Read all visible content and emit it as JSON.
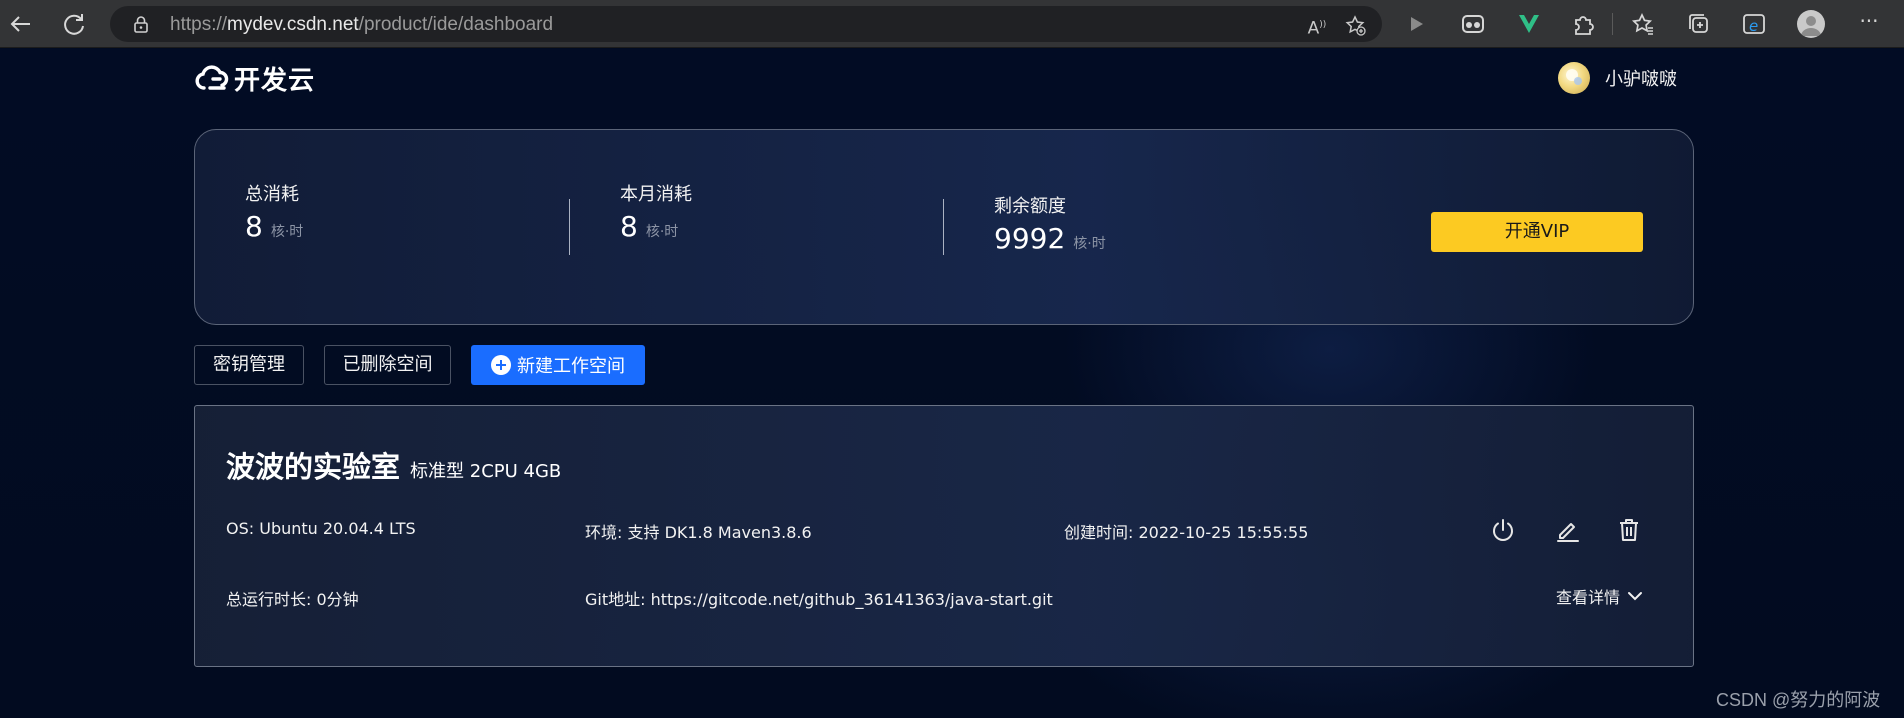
{
  "browser": {
    "url_prefix": "https://",
    "url_host": "mydev.csdn.net",
    "url_path": "/product/ide/dashboard",
    "icons": [
      "back-icon",
      "refresh-icon",
      "lock-icon",
      "read-aloud-icon",
      "favorite-add-icon",
      "play-icon",
      "extension-icon",
      "vue-icon",
      "puzzle-icon",
      "favorites-icon",
      "collections-icon",
      "ie-mode-icon",
      "profile-icon",
      "more-icon"
    ]
  },
  "header": {
    "logo_text": "开发云",
    "user_name": "小驴啵啵"
  },
  "stats": {
    "total": {
      "label": "总消耗",
      "value": "8",
      "unit": "核·时"
    },
    "month": {
      "label": "本月消耗",
      "value": "8",
      "unit": "核·时"
    },
    "remaining": {
      "label": "剩余额度",
      "value": "9992",
      "unit": "核·时"
    },
    "vip_button": "开通VIP"
  },
  "actions": {
    "keys_button": "密钥管理",
    "deleted_button": "已删除空间",
    "new_button": "新建工作空间"
  },
  "workspace": {
    "name": "波波的实验室",
    "spec": "标准型 2CPU 4GB",
    "os": "OS: Ubuntu 20.04.4 LTS",
    "env": "环境: 支持 DK1.8 Maven3.8.6",
    "created": "创建时间: 2022-10-25 15:55:55",
    "runtime": "总运行时长: 0分钟",
    "git": "Git地址: https://gitcode.net/github_36141363/java-start.git",
    "details": "查看详情"
  },
  "watermark": "CSDN @努力的阿波",
  "colors": {
    "page_bg": "#010b22",
    "accent_blue": "#1a6dff",
    "vip_yellow": "#fcca22"
  }
}
